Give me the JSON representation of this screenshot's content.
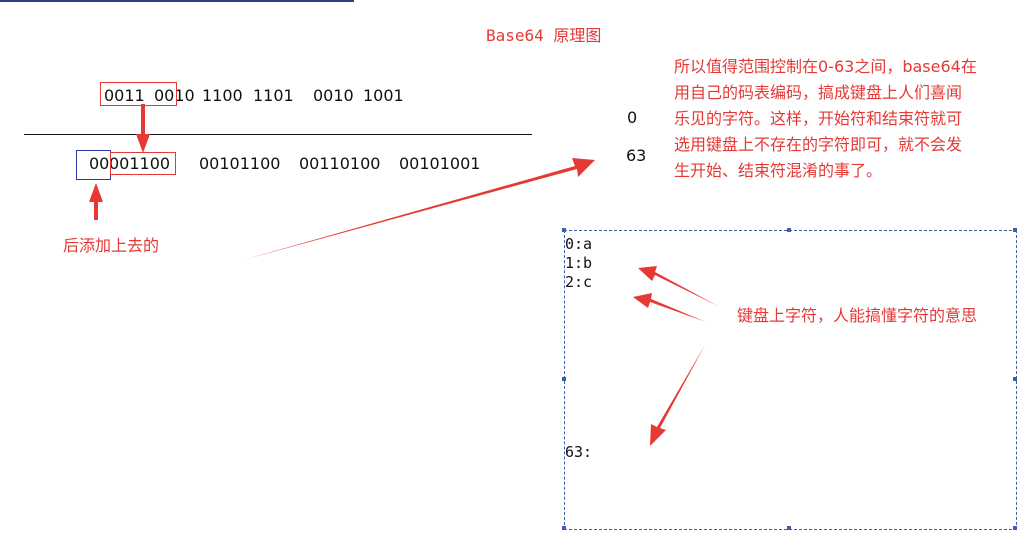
{
  "title": "Base64 原理图",
  "original_bits": [
    "0011",
    "0010",
    "1100",
    "1101",
    "0010",
    "1001"
  ],
  "padded_bytes": {
    "padding": "00",
    "first_rest": "001100",
    "others": [
      "00101100",
      "00110100",
      "00101001"
    ]
  },
  "padding_label": "后添加上去的",
  "range": {
    "min": "0",
    "max": "63"
  },
  "explanation": [
    "所以值得范围控制在0-63之间，base64在",
    "用自己的码表编码，搞成键盘上人们喜闻",
    "乐见的字符。这样，开始符和结束符就可",
    "选用键盘上不存在的字符即可，就不会发",
    "生开始、结束符混淆的事了。"
  ],
  "mapping": [
    "0:a",
    "1:b",
    "2:c"
  ],
  "mapping_last": "63:",
  "keyboard_label": "键盘上字符，人能搞懂字符的意思",
  "colors": {
    "annotation": "#e53935",
    "selection": "#3b5fa8",
    "blue_box": "#2b3aa8",
    "top_rule": "#2c3e7a"
  }
}
